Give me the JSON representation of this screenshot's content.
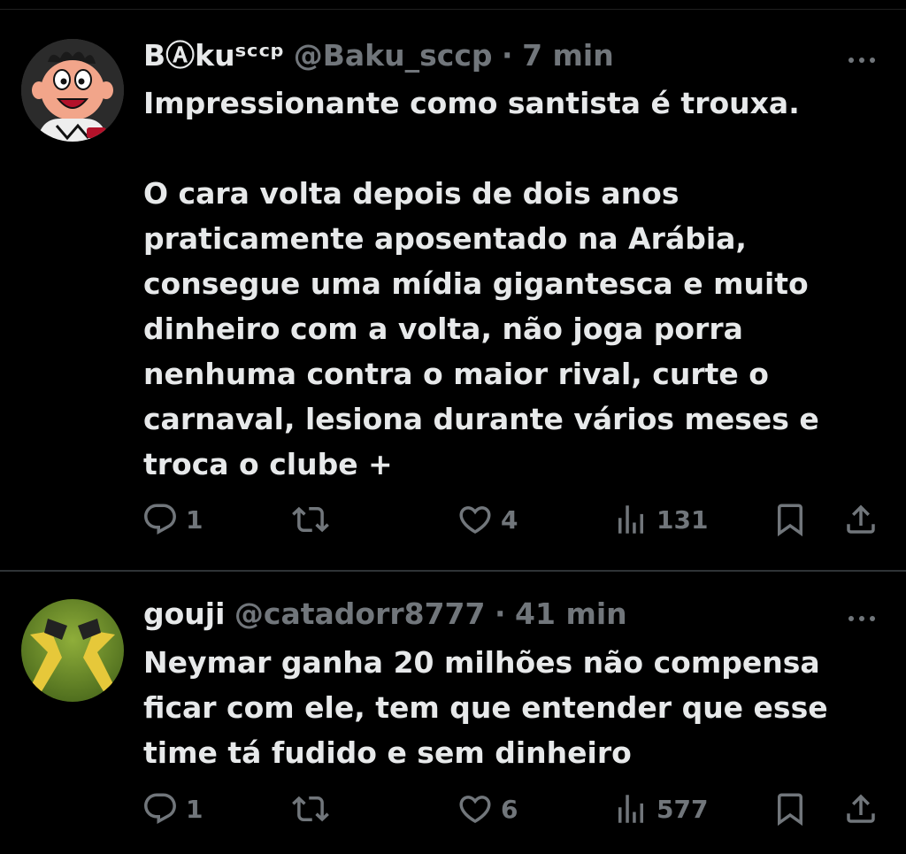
{
  "tweets": [
    {
      "display_name": "BⒶkuˢᶜᶜᵖ",
      "handle": "@Baku_sccp",
      "separator": "·",
      "time": "7 min",
      "text": "Impressionante como santista é trouxa.\n\nO cara volta depois de dois anos\npraticamente aposentado na Arábia,\nconsegue uma mídia gigantesca e muito\ndinheiro com a volta, não joga porra\nnenhuma contra o maior rival, curte o\ncarnaval, lesiona durante vários meses e\ntroca o clube +",
      "replies": "1",
      "retweets": "",
      "likes": "4",
      "views": "131"
    },
    {
      "display_name": "gouji",
      "handle": "@catadorr8777",
      "separator": "·",
      "time": "41 min",
      "text": "Neymar ganha 20 milhões não compensa\nficar com ele, tem que entender que esse\ntime tá fudido e sem dinheiro",
      "replies": "1",
      "retweets": "",
      "likes": "6",
      "views": "577"
    }
  ],
  "icons": {
    "reply": "reply-icon",
    "retweet": "retweet-icon",
    "like": "heart-icon",
    "views": "views-icon",
    "bookmark": "bookmark-icon",
    "share": "share-icon",
    "more": "more-icon"
  },
  "colors": {
    "background": "#000000",
    "text": "#e7e9ea",
    "secondary": "#71767b",
    "divider": "#2f3336"
  }
}
